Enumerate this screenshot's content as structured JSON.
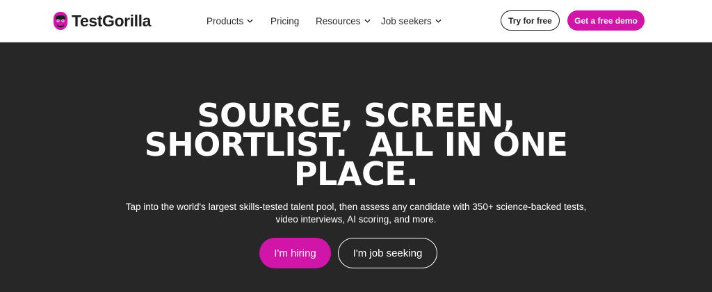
{
  "brand": {
    "name": "TestGorilla",
    "accent_color": "#d115a8",
    "logo_icon": "gorilla-icon"
  },
  "nav": {
    "items": [
      {
        "label": "Products",
        "has_dropdown": true
      },
      {
        "label": "Pricing",
        "has_dropdown": false
      },
      {
        "label": "Resources",
        "has_dropdown": true
      },
      {
        "label": "Job seekers",
        "has_dropdown": true
      }
    ]
  },
  "header_actions": {
    "try_label": "Try for free",
    "demo_label": "Get a free demo"
  },
  "hero": {
    "headline_lines": [
      "SOURCE, SCREEN,",
      "SHORTLIST.  ALL IN ONE",
      "PLACE."
    ],
    "subtext_lines": [
      "Tap into the world's largest skills-tested talent pool, then assess any candidate with 350+ science-backed tests,",
      "video interviews, AI scoring, and more."
    ],
    "primary_cta": "I'm hiring",
    "secondary_cta": "I'm job seeking",
    "background_color": "#272727"
  }
}
